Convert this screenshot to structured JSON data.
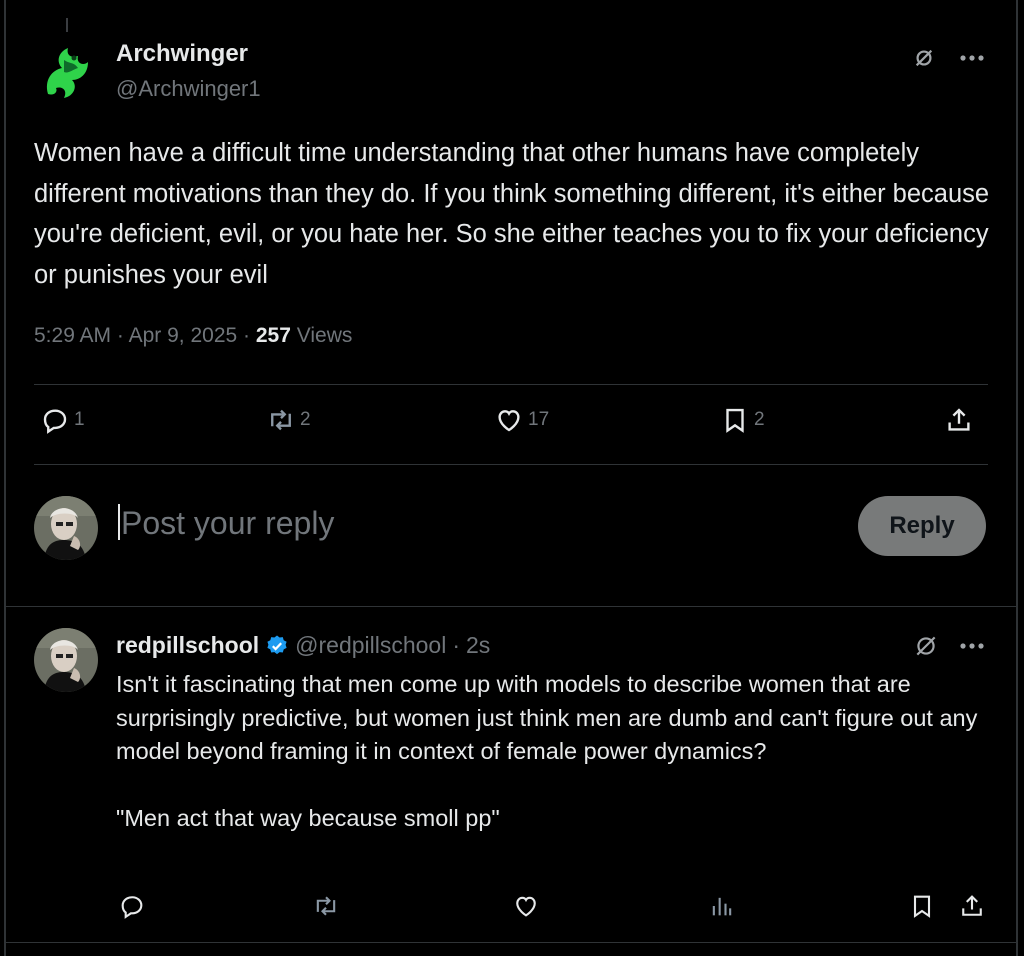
{
  "main_tweet": {
    "display_name": "Archwinger",
    "handle": "@Archwinger1",
    "text": "Women have a difficult time understanding that other humans have completely different motivations than they do. If you think something different, it's either because you're deficient, evil, or you hate her. So she either teaches you to fix your deficiency or punishes your evil",
    "time": "5:29 AM",
    "date": "Apr 9, 2025",
    "views_count": "257",
    "views_label": "Views",
    "separator": "·",
    "stats": {
      "replies": "1",
      "reposts": "2",
      "likes": "17",
      "bookmarks": "2"
    }
  },
  "composer": {
    "placeholder": "Post your reply",
    "reply_button": "Reply"
  },
  "reply_tweet": {
    "display_name": "redpillschool",
    "handle": "@redpillschool",
    "separator": "·",
    "age": "2s",
    "text": "Isn't it fascinating that men come up with models to describe women that are surprisingly predictive, but women just think men are dumb and can't figure out any model beyond framing it in context of female power dynamics?\n\n\"Men act that way because smoll pp\""
  },
  "colors": {
    "background": "#000000",
    "text_primary": "#e7e9ea",
    "text_secondary": "#71767b",
    "divider": "#2f3336",
    "verified_blue": "#1d9bf0",
    "reply_button_bg": "#787a7a"
  },
  "icons": {
    "grok": "grok-icon",
    "more": "more-icon",
    "reply": "reply-icon",
    "repost": "repost-icon",
    "like": "like-icon",
    "bookmark": "bookmark-icon",
    "share": "share-icon",
    "analytics": "analytics-icon",
    "verified": "verified-badge-icon"
  }
}
